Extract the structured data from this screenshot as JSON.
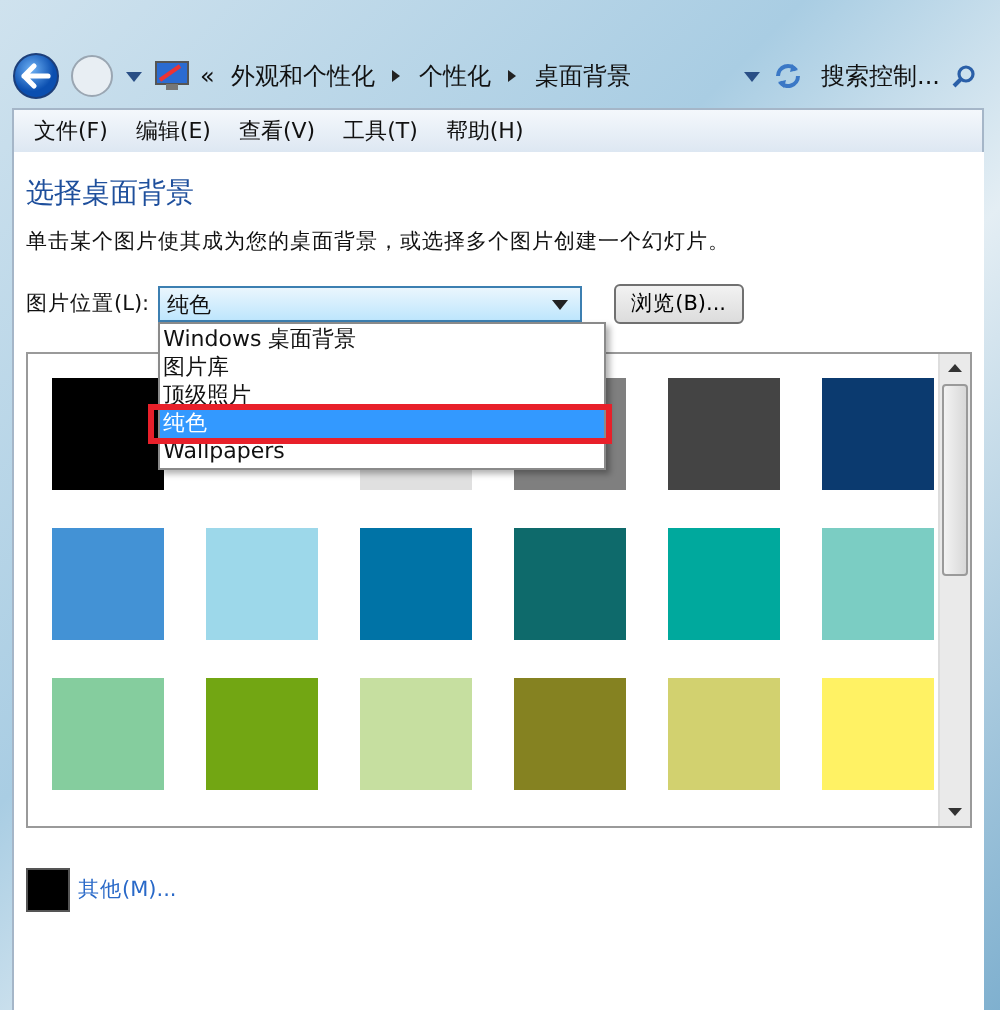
{
  "nav": {
    "overflow": "«",
    "breadcrumb": [
      "外观和个性化",
      "个性化",
      "桌面背景"
    ],
    "search": {
      "placeholder": "搜索控制..."
    }
  },
  "menu": [
    "文件(F)",
    "编辑(E)",
    "查看(V)",
    "工具(T)",
    "帮助(H)"
  ],
  "heading": "选择桌面背景",
  "description": "单击某个图片使其成为您的桌面背景，或选择多个图片创建一个幻灯片。",
  "location": {
    "label": "图片位置(L):",
    "value": "纯色",
    "browse": "浏览(B)...",
    "options": [
      {
        "label": "Windows 桌面背景",
        "selected": false,
        "highlighted": false
      },
      {
        "label": "图片库",
        "selected": false,
        "highlighted": false
      },
      {
        "label": "顶级照片",
        "selected": false,
        "highlighted": false
      },
      {
        "label": "纯色",
        "selected": true,
        "highlighted": true
      },
      {
        "label": "Wallpapers",
        "selected": false,
        "highlighted": false
      }
    ]
  },
  "swatch_rows": [
    [
      {
        "color": "#000000"
      },
      null,
      {
        "color": "#e0e0e0"
      },
      {
        "color": "#7f7f7f"
      },
      {
        "color": "#444444"
      },
      {
        "color": "#0b3a6f"
      }
    ],
    [
      {
        "color": "#4392d5"
      },
      {
        "color": "#9dd8ea"
      },
      {
        "color": "#0073a6"
      },
      {
        "color": "#0e6a6b"
      },
      {
        "color": "#00a99d"
      },
      {
        "color": "#7bcdc3"
      }
    ],
    [
      {
        "color": "#85cd9e"
      },
      {
        "color": "#72a613"
      },
      {
        "color": "#c6dfa0"
      },
      {
        "color": "#858221"
      },
      {
        "color": "#d2d16f"
      },
      {
        "color": "#fff264"
      }
    ]
  ],
  "other": {
    "color": "#000000",
    "link": "其他(M)..."
  }
}
